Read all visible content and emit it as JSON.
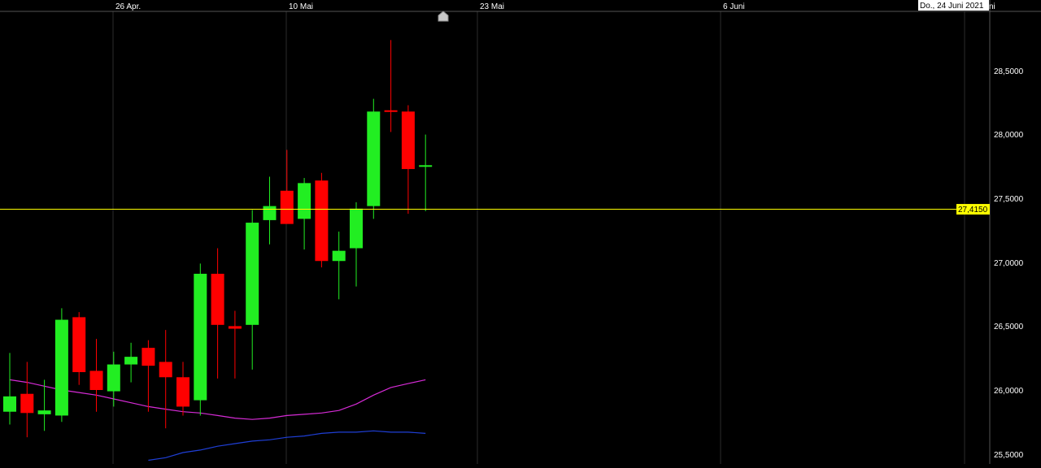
{
  "chart_data": {
    "type": "candlestick",
    "x_axis": {
      "tick_labels": [
        "26 Apr.",
        "10 Mai",
        "23 Mai",
        "6 Juni"
      ],
      "cursor_date_label": "Do., 24 Juni 2021",
      "truncated_label": "ni"
    },
    "y_axis": {
      "tick_labels": [
        "28,5000",
        "28,0000",
        "27,5000",
        "27,0000",
        "26,5000",
        "26,0000",
        "25,5000"
      ],
      "range": [
        25.4,
        28.75
      ]
    },
    "last_price": {
      "label": "27,4150",
      "value": 27.415
    },
    "candles": [
      {
        "open": 25.83,
        "high": 26.29,
        "low": 25.73,
        "close": 25.95
      },
      {
        "open": 25.97,
        "high": 26.22,
        "low": 25.63,
        "close": 25.82
      },
      {
        "open": 25.81,
        "high": 26.08,
        "low": 25.68,
        "close": 25.84
      },
      {
        "open": 25.8,
        "high": 26.64,
        "low": 25.75,
        "close": 26.55
      },
      {
        "open": 26.57,
        "high": 26.61,
        "low": 26.04,
        "close": 26.14
      },
      {
        "open": 26.15,
        "high": 26.4,
        "low": 25.83,
        "close": 26.0
      },
      {
        "open": 25.99,
        "high": 26.3,
        "low": 25.87,
        "close": 26.2
      },
      {
        "open": 26.2,
        "high": 26.37,
        "low": 26.06,
        "close": 26.26
      },
      {
        "open": 26.33,
        "high": 26.39,
        "low": 25.83,
        "close": 26.19
      },
      {
        "open": 26.22,
        "high": 26.47,
        "low": 25.7,
        "close": 26.1
      },
      {
        "open": 26.1,
        "high": 26.22,
        "low": 25.8,
        "close": 25.87
      },
      {
        "open": 25.92,
        "high": 26.99,
        "low": 25.8,
        "close": 26.91
      },
      {
        "open": 26.91,
        "high": 27.11,
        "low": 26.09,
        "close": 26.51
      },
      {
        "open": 26.5,
        "high": 26.62,
        "low": 26.09,
        "close": 26.48
      },
      {
        "open": 26.51,
        "high": 27.41,
        "low": 26.16,
        "close": 27.31
      },
      {
        "open": 27.33,
        "high": 27.67,
        "low": 27.14,
        "close": 27.44
      },
      {
        "open": 27.56,
        "high": 27.88,
        "low": 27.39,
        "close": 27.3
      },
      {
        "open": 27.34,
        "high": 27.66,
        "low": 27.1,
        "close": 27.62
      },
      {
        "open": 27.64,
        "high": 27.7,
        "low": 26.96,
        "close": 27.01
      },
      {
        "open": 27.01,
        "high": 27.24,
        "low": 26.71,
        "close": 27.09
      },
      {
        "open": 27.11,
        "high": 27.47,
        "low": 26.81,
        "close": 27.42
      },
      {
        "open": 27.44,
        "high": 28.28,
        "low": 27.34,
        "close": 28.18
      },
      {
        "open": 28.19,
        "high": 28.74,
        "low": 28.02,
        "close": 28.18
      },
      {
        "open": 28.18,
        "high": 28.23,
        "low": 27.38,
        "close": 27.73
      },
      {
        "open": 27.75,
        "high": 28.0,
        "low": 27.4,
        "close": 27.76
      }
    ],
    "series": [
      {
        "color": "#d62bd6",
        "values": [
          26.08,
          26.06,
          26.03,
          26.0,
          25.98,
          25.96,
          25.93,
          25.9,
          25.87,
          25.85,
          25.83,
          25.82,
          25.8,
          25.78,
          25.77,
          25.78,
          25.8,
          25.81,
          25.82,
          25.84,
          25.89,
          25.96,
          26.02,
          26.05,
          26.08
        ]
      },
      {
        "color": "#1f3fd6",
        "values": [
          null,
          null,
          null,
          null,
          null,
          null,
          null,
          null,
          25.45,
          25.47,
          25.51,
          25.53,
          25.56,
          25.58,
          25.6,
          25.61,
          25.63,
          25.64,
          25.66,
          25.67,
          25.67,
          25.68,
          25.67,
          25.67,
          25.66
        ]
      }
    ],
    "colors": {
      "up": "#22ee22",
      "down": "#ff0000",
      "last_price_line": "#ffff00",
      "last_price_badge": "#ffff00",
      "grid": "#2b2b2b",
      "axis_text": "#ffffff"
    },
    "grid": true,
    "scroll_marker_icon": "house-arrow-icon"
  }
}
